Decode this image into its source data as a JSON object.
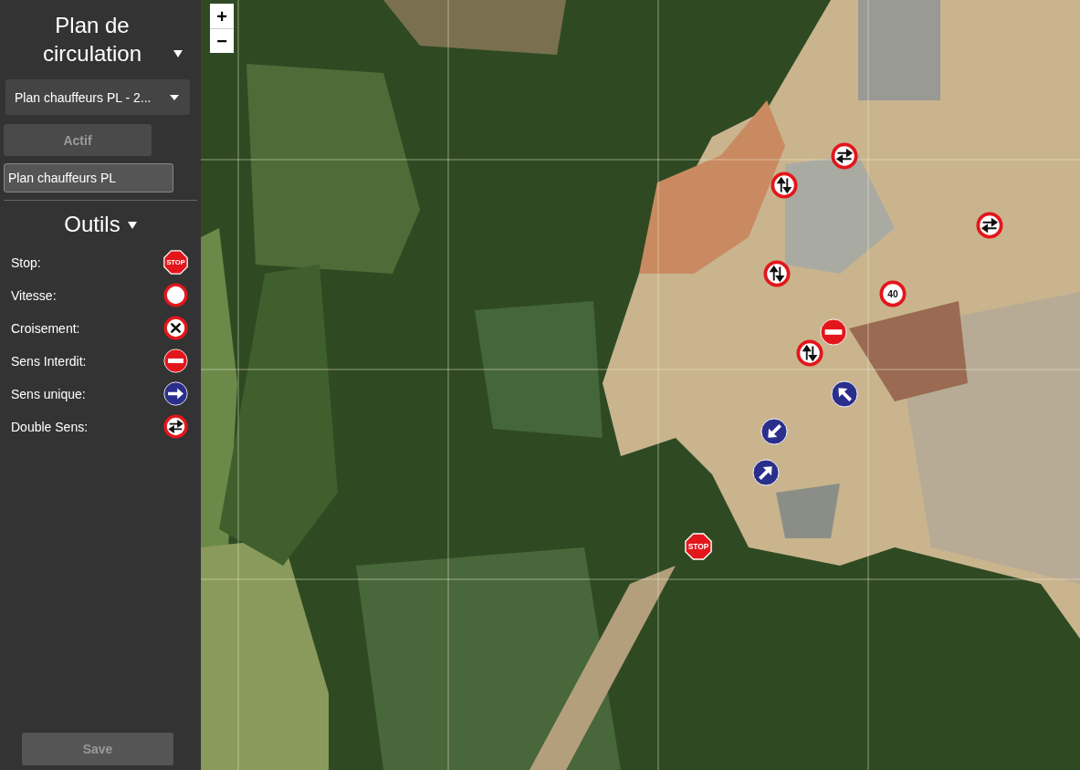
{
  "sidebar": {
    "title": "Plan de circulation",
    "plan_select": {
      "value": "Plan chauffeurs PL - 2..."
    },
    "active_button": {
      "label": "Actif",
      "disabled": true
    },
    "plan_name_field": {
      "value": "Plan chauffeurs PL"
    },
    "tools_title": "Outils",
    "tools": [
      {
        "label": "Stop:",
        "kind": "stop",
        "sign_text": "STOP"
      },
      {
        "label": "Vitesse:",
        "kind": "speed"
      },
      {
        "label": "Croisement:",
        "kind": "crossing"
      },
      {
        "label": "Sens Interdit:",
        "kind": "no-entry"
      },
      {
        "label": "Sens unique:",
        "kind": "one-way-right"
      },
      {
        "label": "Double Sens:",
        "kind": "two-way-horizontal"
      }
    ],
    "save_button": {
      "label": "Save",
      "disabled": true
    }
  },
  "map": {
    "zoom_in": "+",
    "zoom_out": "−",
    "markers": [
      {
        "kind": "two-way-horizontal"
      },
      {
        "kind": "two-way-vertical"
      },
      {
        "kind": "two-way-horizontal"
      },
      {
        "kind": "two-way-vertical"
      },
      {
        "kind": "speed",
        "text": "40"
      },
      {
        "kind": "no-entry"
      },
      {
        "kind": "two-way-vertical"
      },
      {
        "kind": "one-way-up-left"
      },
      {
        "kind": "one-way-down-left"
      },
      {
        "kind": "one-way-up-right"
      },
      {
        "kind": "stop",
        "text": "STOP"
      }
    ]
  }
}
